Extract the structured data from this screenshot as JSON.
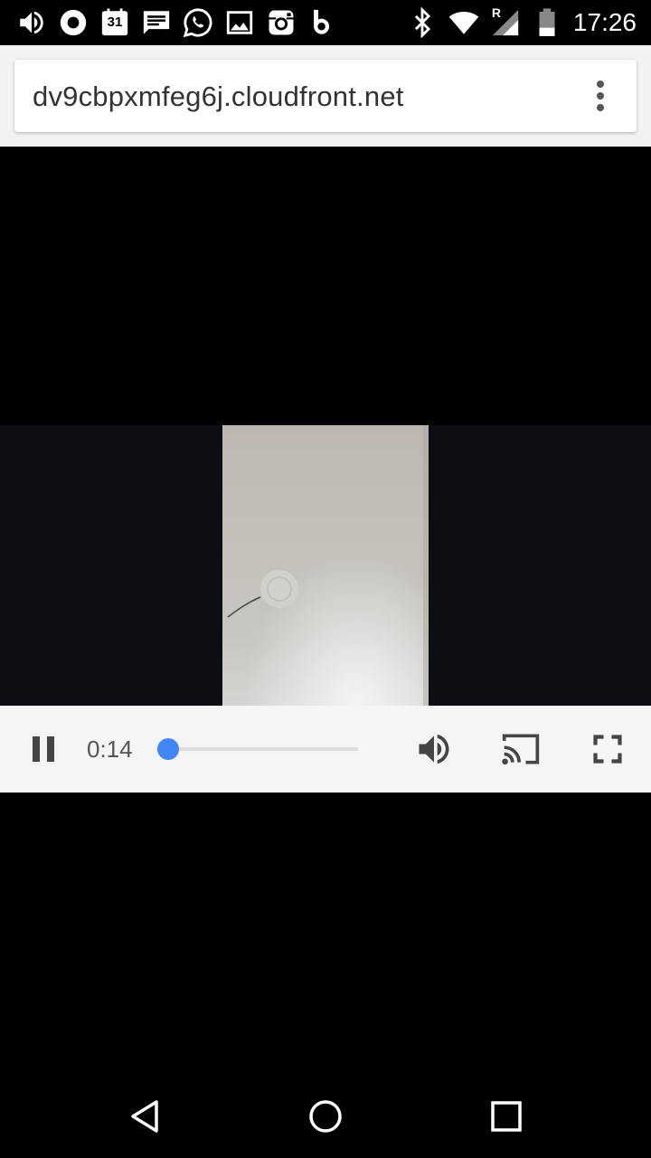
{
  "status_bar": {
    "time": "17:26",
    "calendar_day": "31",
    "network_roaming": "R",
    "left_icons": [
      "volume-icon",
      "record-icon",
      "calendar-icon",
      "message-icon",
      "whatsapp-icon",
      "gallery-icon",
      "instagram-icon",
      "b-app-icon"
    ],
    "right_icons": [
      "bluetooth-icon",
      "wifi-icon",
      "cell-signal-icon",
      "battery-icon"
    ]
  },
  "browser": {
    "url": "dv9cbpxmfeg6j.cloudfront.net",
    "menu_icon": "more-vert-icon"
  },
  "player": {
    "current_time": "0:14",
    "progress": 0.0,
    "accent_color": "#4285f4",
    "controls": [
      "pause-icon",
      "volume-icon",
      "cast-icon",
      "fullscreen-icon"
    ]
  },
  "nav": {
    "buttons": [
      "back-icon",
      "home-icon",
      "recents-icon"
    ]
  }
}
